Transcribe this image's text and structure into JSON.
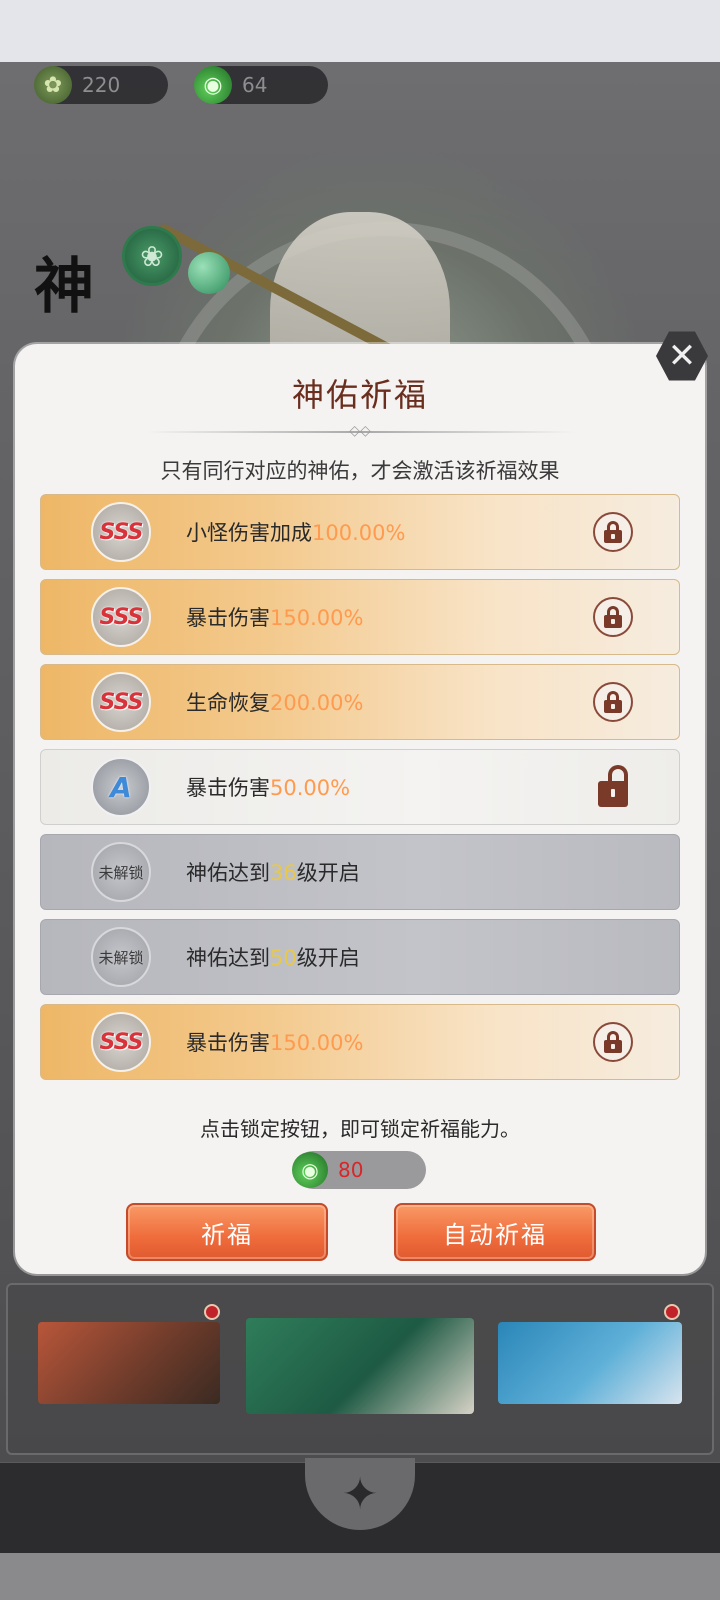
{
  "resources": {
    "leaf": {
      "icon": "leaf-icon",
      "value": "220"
    },
    "potion": {
      "icon": "potion-icon",
      "value": "64"
    }
  },
  "side_title": "神",
  "modal": {
    "title": "神佑祈福",
    "subtitle": "只有同行对应的神佑，才会激活该祈福效果",
    "rows": [
      {
        "grade": "SSS",
        "label": "小怪伤害加成",
        "value": "100.00%",
        "state": "lockable"
      },
      {
        "grade": "SSS",
        "label": "暴击伤害",
        "value": "150.00%",
        "state": "lockable"
      },
      {
        "grade": "SSS",
        "label": "生命恢复",
        "value": "200.00%",
        "state": "lockable"
      },
      {
        "grade": "A",
        "label": "暴击伤害",
        "value": "50.00%",
        "state": "unlocked"
      },
      {
        "grade": "未解锁",
        "label_pre": "神佑达到",
        "level": "36",
        "label_post": "级开启",
        "state": "unavailable"
      },
      {
        "grade": "未解锁",
        "label_pre": "神佑达到",
        "level": "50",
        "label_post": "级开启",
        "state": "unavailable"
      },
      {
        "grade": "SSS",
        "label": "暴击伤害",
        "value": "150.00%",
        "state": "lockable"
      }
    ],
    "hint": "点击锁定按钮，即可锁定祈福能力。",
    "cost": {
      "icon": "potion-icon",
      "value": "80"
    },
    "buttons": {
      "bless": "祈福",
      "auto_bless": "自动祈福"
    }
  },
  "colors": {
    "accent": "#ef6c3c",
    "value_orange": "#ff9a4e",
    "level_yellow": "#e8c84a",
    "cost_red": "#d8262a",
    "title_brown": "#6a2e1e"
  }
}
